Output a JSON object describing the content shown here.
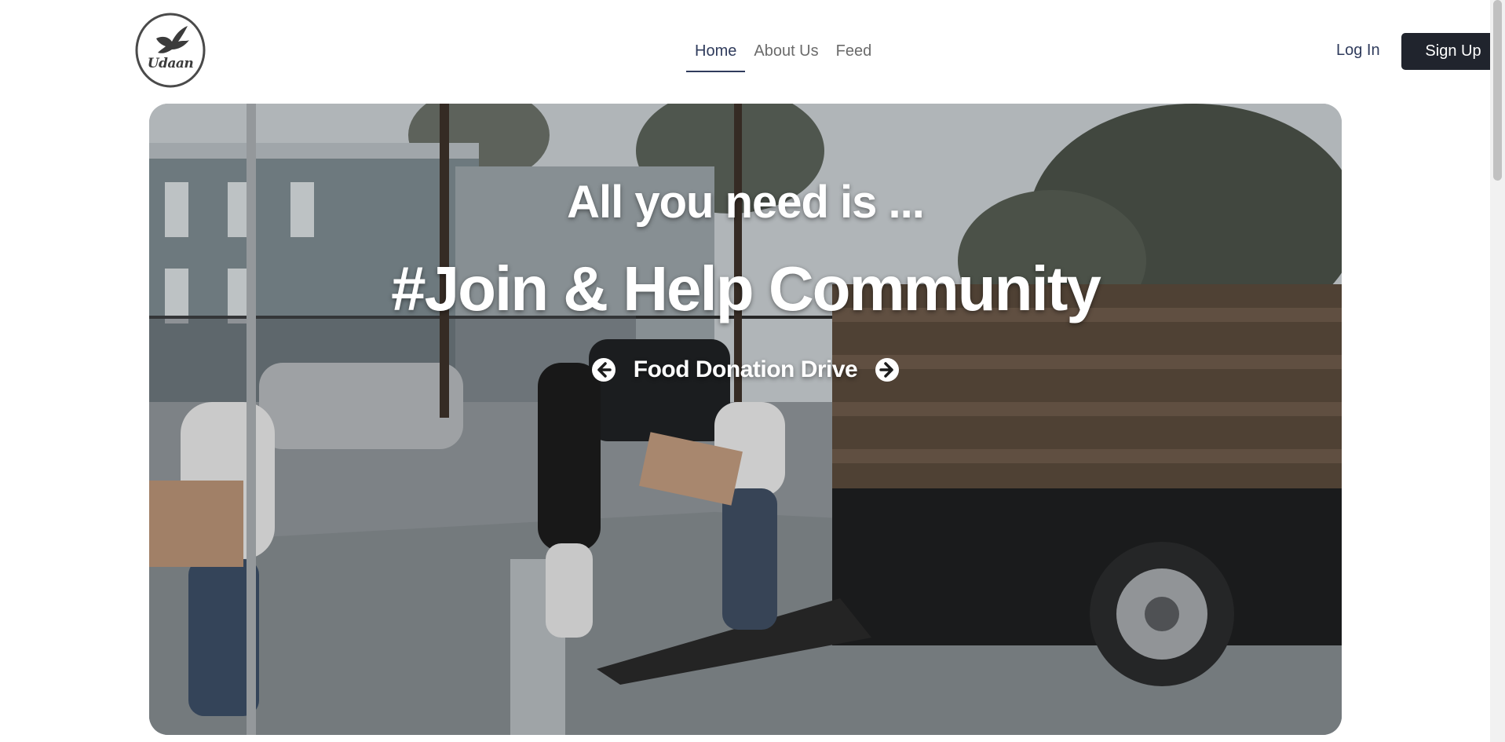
{
  "brand": {
    "name": "Udaan",
    "logo_icon": "bird-icon"
  },
  "nav": {
    "links": [
      {
        "label": "Home",
        "active": true
      },
      {
        "label": "About Us",
        "active": false
      },
      {
        "label": "Feed",
        "active": false
      }
    ],
    "login_label": "Log In",
    "signup_label": "Sign Up"
  },
  "hero": {
    "tagline": "All you need is ...",
    "headline": "#Join & Help Community",
    "slide_title": "Food Donation Drive",
    "prev_icon": "arrow-circle-left-icon",
    "next_icon": "arrow-circle-right-icon"
  },
  "colors": {
    "nav_active": "#2f3b5c",
    "signup_bg": "#20242d"
  }
}
